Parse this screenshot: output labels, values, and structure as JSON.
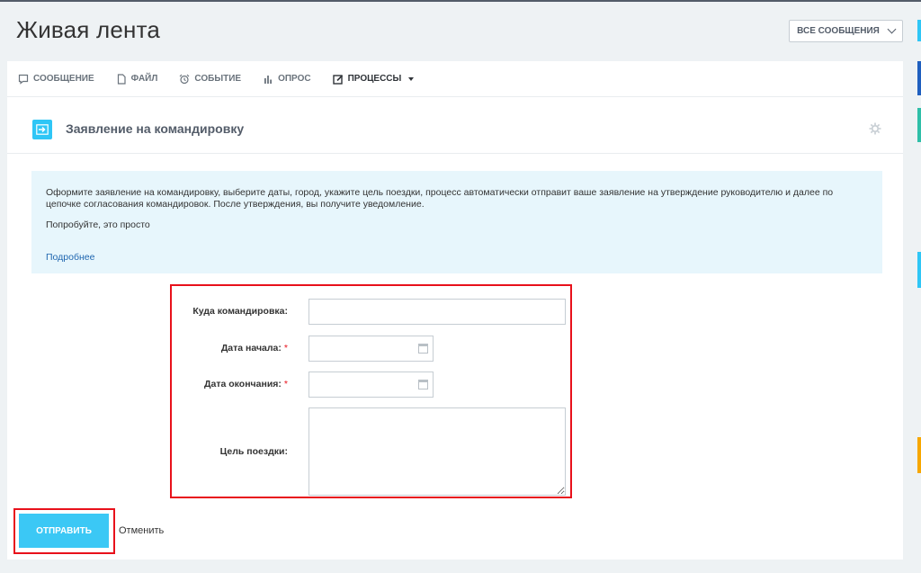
{
  "header": {
    "title": "Живая лента",
    "filter_label": "ВСЕ СООБЩЕНИЯ"
  },
  "tabs": [
    {
      "label": "СООБЩЕНИЕ",
      "icon": "speech-bubble-icon"
    },
    {
      "label": "ФАЙЛ",
      "icon": "file-icon"
    },
    {
      "label": "СОБЫТИЕ",
      "icon": "alarm-clock-icon"
    },
    {
      "label": "ОПРОС",
      "icon": "bar-chart-icon"
    },
    {
      "label": "ПРОЦЕССЫ",
      "icon": "edit-icon",
      "active": true
    }
  ],
  "form": {
    "title": "Заявление на командировку",
    "info_text": "Оформите заявление на командировку, выберите даты, город, укажите цель поездки, процесс автоматически отправит ваше заявление на утверждение руководителю и далее по цепочке согласования командировок. После утверждения, вы получите уведомление.",
    "info_hint": "Попробуйте, это просто",
    "more_link": "Подробнее",
    "fields": {
      "destination_label": "Куда командировка:",
      "start_label": "Дата начала:",
      "end_label": "Дата окончания:",
      "purpose_label": "Цель поездки:",
      "required_mark": "*"
    },
    "submit_label": "ОТПРАВИТЬ",
    "cancel_label": "Отменить"
  },
  "colors": {
    "accent": "#3bc8f5",
    "highlight": "#e8111b",
    "info_bg": "#e7f6fc"
  }
}
